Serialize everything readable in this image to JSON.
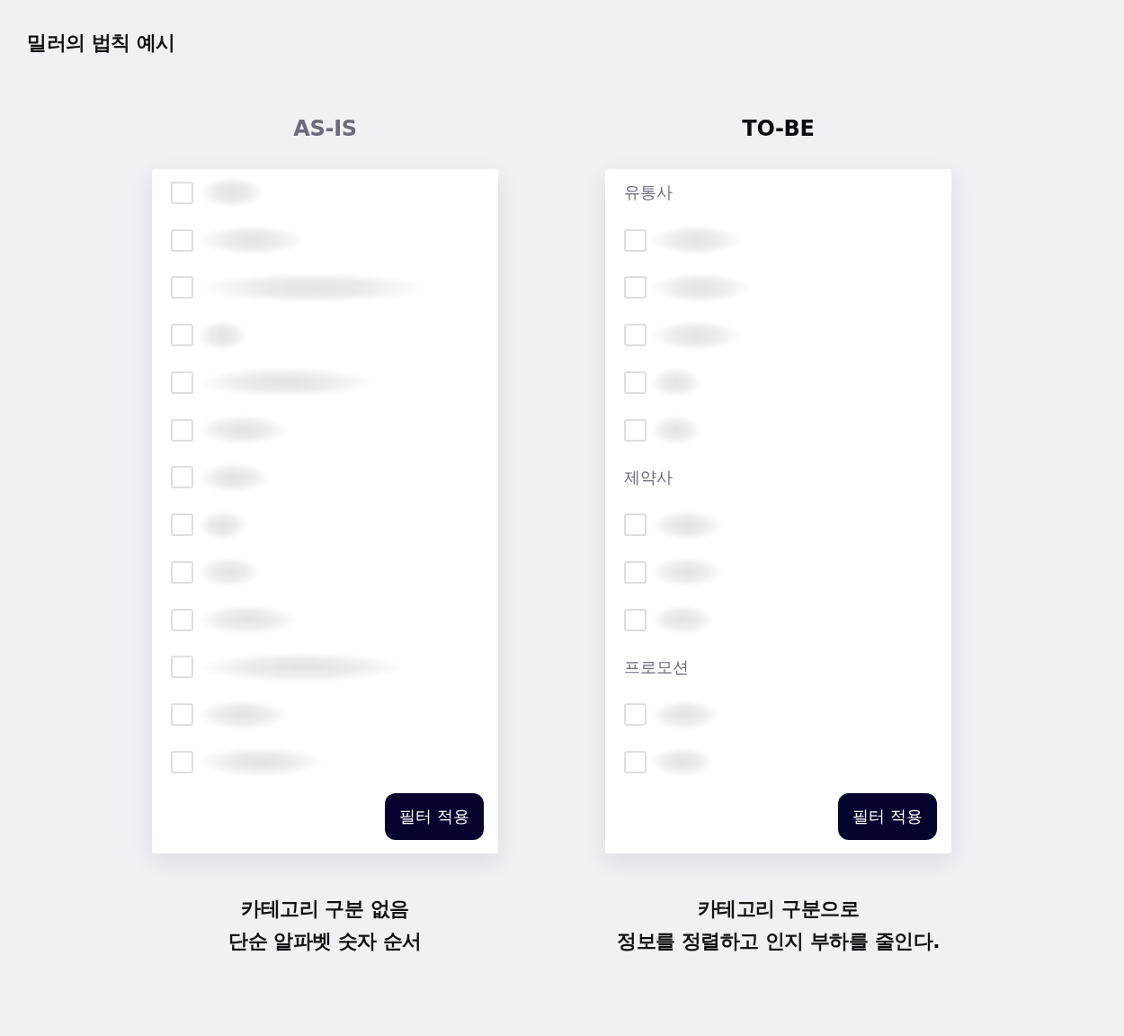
{
  "title": "밀러의 법칙 예시",
  "panels": [
    {
      "heading": "AS-IS",
      "active": false,
      "items": [
        {
          "kind": "option",
          "checked": false
        },
        {
          "kind": "option",
          "checked": false
        },
        {
          "kind": "option",
          "checked": false
        },
        {
          "kind": "option",
          "checked": false
        },
        {
          "kind": "option",
          "checked": false
        },
        {
          "kind": "option",
          "checked": false
        },
        {
          "kind": "option",
          "checked": false
        },
        {
          "kind": "option",
          "checked": false
        },
        {
          "kind": "option",
          "checked": false
        },
        {
          "kind": "option",
          "checked": false
        },
        {
          "kind": "option",
          "checked": false
        },
        {
          "kind": "option",
          "checked": false
        },
        {
          "kind": "option",
          "checked": false
        }
      ],
      "button": "필터 적용",
      "caption": [
        "카테고리 구분 없음",
        "단순 알파벳 숫자 순서"
      ]
    },
    {
      "heading": "TO-BE",
      "active": true,
      "items": [
        {
          "kind": "section",
          "label": "유통사"
        },
        {
          "kind": "option",
          "checked": false
        },
        {
          "kind": "option",
          "checked": false
        },
        {
          "kind": "option",
          "checked": false
        },
        {
          "kind": "option",
          "checked": false
        },
        {
          "kind": "option",
          "checked": false
        },
        {
          "kind": "section",
          "label": "제약사"
        },
        {
          "kind": "option",
          "checked": false
        },
        {
          "kind": "option",
          "checked": false
        },
        {
          "kind": "option",
          "checked": false
        },
        {
          "kind": "section",
          "label": "프로모션"
        },
        {
          "kind": "option",
          "checked": false
        },
        {
          "kind": "option",
          "checked": false
        }
      ],
      "button": "필터 적용",
      "caption": [
        "카테고리 구분으로",
        "정보를 정렬하고 인지 부하를 줄인다."
      ]
    }
  ]
}
